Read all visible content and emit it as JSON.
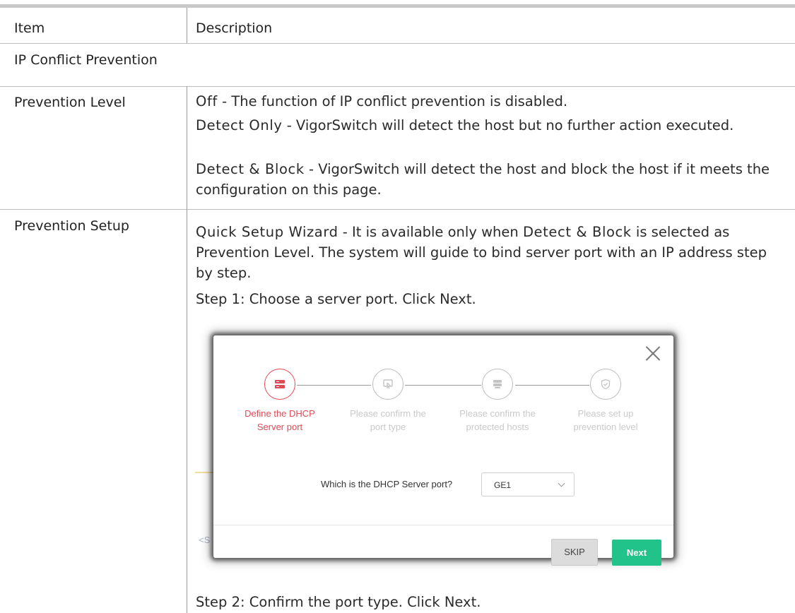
{
  "table": {
    "header": {
      "item": "Item",
      "description": "Description"
    },
    "section_title": "IP Conflict Prevention",
    "rows": [
      {
        "item": "Prevention Level",
        "lines": [
          {
            "term": "Off",
            "text": " - The function of IP conflict prevention is disabled."
          },
          {
            "term": "Detect Only",
            "text": " - VigorSwitch will detect the host but no further action executed."
          },
          {
            "term": "Detect & Block",
            "text": " - VigorSwitch will detect the host and block the host if it meets the configuration on this page."
          }
        ]
      },
      {
        "item": "Prevention Setup",
        "intro": {
          "term": "Quick Setup Wizard",
          "pre": " - It is available only when ",
          "term2": "Detect & Block",
          "post": " is selected as Prevention Level. The system will guide to bind server port with an IP address step by step."
        },
        "step1": "Step 1: Choose a server port. Click Next.",
        "step2": "Step 2: Confirm the port type. Click Next."
      }
    ]
  },
  "dialog": {
    "steps": [
      {
        "line1": "Define the DHCP",
        "line2": "Server port",
        "icon": "server-icon",
        "active": true
      },
      {
        "line1": "Please confirm the",
        "line2": "port type",
        "icon": "port-icon",
        "active": false
      },
      {
        "line1": "Please confirm the",
        "line2": "protected hosts",
        "icon": "hosts-icon",
        "active": false
      },
      {
        "line1": "Please set up",
        "line2": "prevention level",
        "icon": "shield-check-icon",
        "active": false
      }
    ],
    "question": "Which is the DHCP Server port?",
    "select_value": "GE1",
    "skip_label": "SKIP",
    "next_label": "Next",
    "colors": {
      "active": "#e04a55",
      "next_button": "#22c38a"
    }
  }
}
